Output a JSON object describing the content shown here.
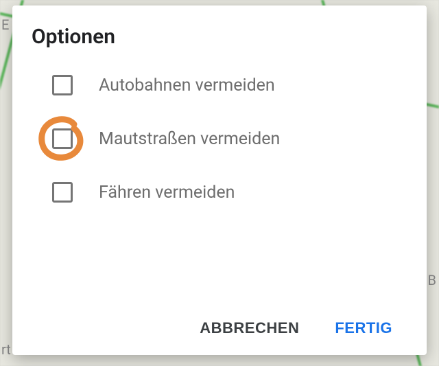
{
  "dialog": {
    "title": "Optionen",
    "options": [
      {
        "label": "Autobahnen vermeiden",
        "checked": false
      },
      {
        "label": "Mautstraßen vermeiden",
        "checked": false
      },
      {
        "label": "Fähren vermeiden",
        "checked": false
      }
    ],
    "cancel_label": "ABBRECHEN",
    "done_label": "FERTIG"
  },
  "annotation": {
    "target_option_index": 1,
    "color": "#e8893b"
  }
}
